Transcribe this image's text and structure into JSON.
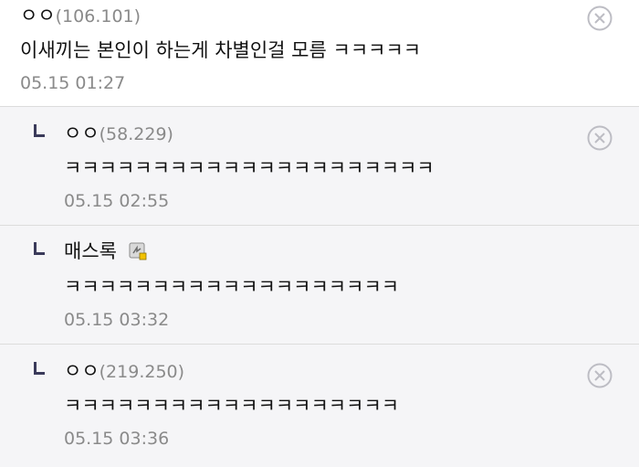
{
  "comments": [
    {
      "author": "ㅇㅇ",
      "ip": "(106.101)",
      "text": "이새끼는 본인이 하는게 차별인걸 모름 ㅋㅋㅋㅋㅋ",
      "time": "05.15 01:27"
    }
  ],
  "replies": [
    {
      "author": "ㅇㅇ",
      "ip": "(58.229)",
      "text": "ㅋㅋㅋㅋㅋㅋㅋㅋㅋㅋㅋㅋㅋㅋㅋㅋㅋㅋㅋㅋㅋ",
      "time": "05.15 02:55"
    },
    {
      "author": "매스록",
      "ip": "",
      "text": "ㅋㅋㅋㅋㅋㅋㅋㅋㅋㅋㅋㅋㅋㅋㅋㅋㅋㅋㅋ",
      "time": "05.15 03:32"
    },
    {
      "author": "ㅇㅇ",
      "ip": "(219.250)",
      "text": "ㅋㅋㅋㅋㅋㅋㅋㅋㅋㅋㅋㅋㅋㅋㅋㅋㅋㅋㅋ",
      "time": "05.15 03:36"
    }
  ],
  "watermark": "dcinside watermark",
  "icons": {
    "close": "close-circle-icon",
    "reply": "reply-arrow-icon",
    "badge": "fixed-nick-badge-icon"
  },
  "colors": {
    "reply_bg": "#f5f5f7",
    "meta": "#8a8a8a",
    "marker": "#3a3a5a"
  }
}
